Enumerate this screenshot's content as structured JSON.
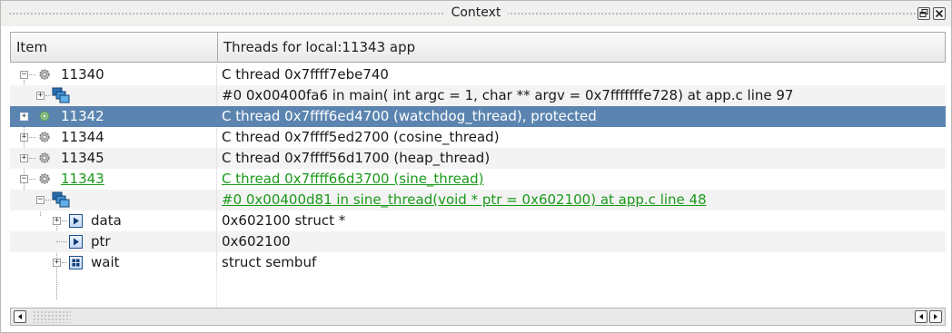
{
  "window": {
    "title": "Context",
    "restore_icon": "restore-window-icon",
    "close_icon": "close-icon"
  },
  "columns": {
    "item": "Item",
    "value": "Threads for local:11343 app"
  },
  "rows": [
    {
      "item": "11340",
      "value": "C thread 0x7ffff7ebe740"
    },
    {
      "item": "",
      "value": "#0 0x00400fa6 in main( int argc = 1, char ** argv = 0x7fffffffe728) at app.c line 97"
    },
    {
      "item": "11342",
      "value": "C thread 0x7ffff6ed4700 (watchdog_thread), protected"
    },
    {
      "item": "11344",
      "value": "C thread 0x7ffff5ed2700 (cosine_thread)"
    },
    {
      "item": "11345",
      "value": "C thread 0x7ffff56d1700 (heap_thread)"
    },
    {
      "item": "11343",
      "value": "C thread 0x7ffff66d3700 (sine_thread)"
    },
    {
      "item": "",
      "value": "#0 0x00400d81 in sine_thread(void * ptr = 0x602100) at app.c line 48"
    },
    {
      "item": "data",
      "value": "0x602100 struct *"
    },
    {
      "item": "ptr",
      "value": "0x602100"
    },
    {
      "item": "wait",
      "value": "struct sembuf"
    }
  ],
  "colors": {
    "selection": "#5b85b0",
    "current_thread": "#1a9a1a",
    "stack_icon": "#1f6fa8"
  }
}
